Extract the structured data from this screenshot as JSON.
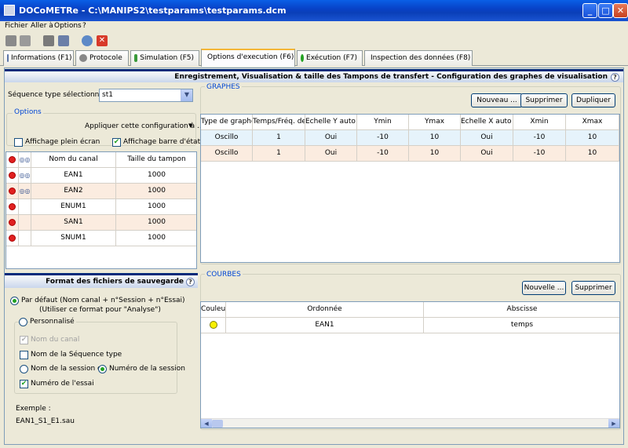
{
  "window": {
    "title": "DOCoMETRe - C:\\MANIPS2\\testparams\\testparams.dcm",
    "min": "_",
    "max": "□",
    "close": "✕"
  },
  "menu": [
    "Fichier",
    "Aller à",
    "Options",
    "?"
  ],
  "tabs": [
    {
      "label": "Informations (F1)"
    },
    {
      "label": "Protocole"
    },
    {
      "label": "Simulation (F5)"
    },
    {
      "label": "Options d'execution (F6)"
    },
    {
      "label": "Exécution (F7)"
    },
    {
      "label": "Inspection des données (F8)"
    }
  ],
  "header": {
    "title": "Enregistrement, Visualisation & taille des Tampons de transfert - Configuration des graphes de visualisation",
    "help": "?"
  },
  "left": {
    "sequence_label": "Séquence type sélectionnée :",
    "sequence_value": "st1",
    "options_title": "Options",
    "apply_label": "Appliquer cette configuration à ...",
    "fullscreen_label": "Affichage plein écran",
    "fullscreen_checked": false,
    "statusbar_label": "Affichage barre d'état",
    "statusbar_checked": true,
    "channel_headers": [
      "Nom du canal",
      "Taille du tampon"
    ],
    "channels": [
      {
        "name": "EAN1",
        "size": "1000",
        "glasses": true
      },
      {
        "name": "EAN2",
        "size": "1000",
        "glasses": true
      },
      {
        "name": "ENUM1",
        "size": "1000",
        "glasses": false
      },
      {
        "name": "SAN1",
        "size": "1000",
        "glasses": false
      },
      {
        "name": "SNUM1",
        "size": "1000",
        "glasses": false
      }
    ],
    "save_format_title": "Format des fichiers de sauvegarde",
    "default_radio": "Par défaut (Nom canal + n°Session + n°Essai)",
    "default_note": "(Utiliser ce format pour \"Analyse\")",
    "custom_radio": "Personnalisé",
    "channel_name_cb": "Nom du canal",
    "seq_name_cb": "Nom de la Séquence type",
    "session_name_radio": "Nom de la session ou",
    "session_num_radio": "Numéro de la session",
    "trial_num_cb": "Numéro de l'essai",
    "example_label": "Exemple :",
    "example_value": "EAN1_S1_E1.sau"
  },
  "graphes": {
    "title": "GRAPHES",
    "buttons": {
      "new": "Nouveau ...",
      "delete": "Supprimer",
      "duplicate": "Dupliquer"
    },
    "headers": [
      "Type de graphe",
      "Temps/Fréq. de visu",
      "Echelle Y auto ?",
      "Ymin",
      "Ymax",
      "Echelle X auto ?",
      "Xmin",
      "Xmax"
    ],
    "rows": [
      [
        "Oscillo",
        "1",
        "Oui",
        "-10",
        "10",
        "Oui",
        "-10",
        "10"
      ],
      [
        "Oscillo",
        "1",
        "Oui",
        "-10",
        "10",
        "Oui",
        "-10",
        "10"
      ]
    ]
  },
  "courbes": {
    "title": "COURBES",
    "buttons": {
      "new": "Nouvelle ...",
      "delete": "Supprimer"
    },
    "headers": [
      "Couleur",
      "Ordonnée",
      "Abscisse"
    ],
    "rows": [
      {
        "color": "#f8f000",
        "ordinate": "EAN1",
        "abscissa": "temps"
      }
    ]
  },
  "colors": {
    "accent": "#002a7a",
    "row_a": "#e6f3fb",
    "row_b": "#fbece0"
  }
}
